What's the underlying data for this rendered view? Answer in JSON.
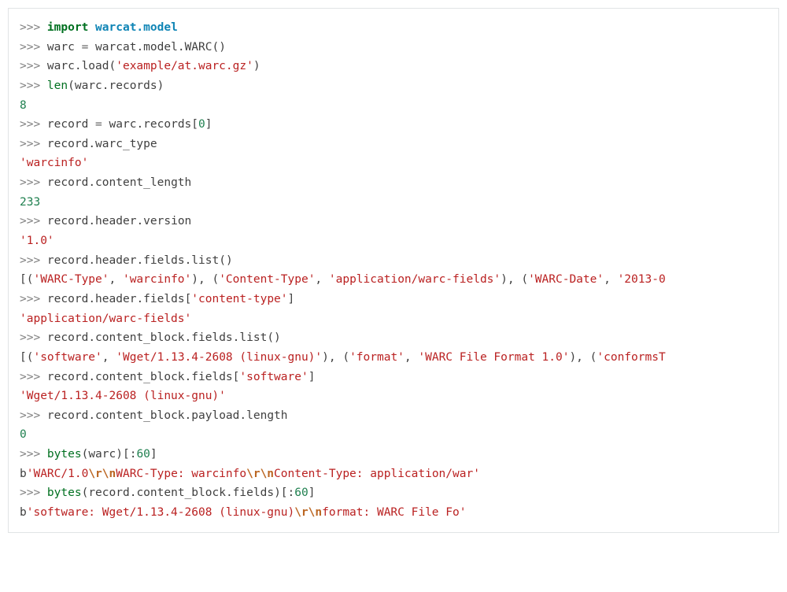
{
  "code": {
    "l1": {
      "prompt": ">>> ",
      "kw_import": "import",
      "space": " ",
      "module": "warcat.model"
    },
    "l2": {
      "prompt": ">>> ",
      "var": "warc",
      "eq": " = ",
      "ns": "warcat",
      "dot1": ".",
      "mod": "model",
      "dot2": ".",
      "cls": "WARC",
      "paren": "()"
    },
    "l3": {
      "prompt": ">>> ",
      "var": "warc",
      "dot": ".",
      "method": "load",
      "open": "(",
      "str": "'example/at.warc.gz'",
      "close": ")"
    },
    "l4": {
      "prompt": ">>> ",
      "builtin": "len",
      "open": "(",
      "var": "warc",
      "dot": ".",
      "attr": "records",
      "close": ")"
    },
    "l5": {
      "out": "8"
    },
    "l6": {
      "prompt": ">>> ",
      "var": "record",
      "eq": " = ",
      "src": "warc",
      "dot": ".",
      "attr": "records",
      "open": "[",
      "idx": "0",
      "close": "]"
    },
    "l7": {
      "prompt": ">>> ",
      "var": "record",
      "dot": ".",
      "attr": "warc_type"
    },
    "l8": {
      "out": "'warcinfo'"
    },
    "l9": {
      "prompt": ">>> ",
      "var": "record",
      "dot": ".",
      "attr": "content_length"
    },
    "l10": {
      "out": "233"
    },
    "l11": {
      "prompt": ">>> ",
      "var": "record",
      "dot1": ".",
      "a1": "header",
      "dot2": ".",
      "a2": "version"
    },
    "l12": {
      "out": "'1.0'"
    },
    "l13": {
      "prompt": ">>> ",
      "var": "record",
      "dot1": ".",
      "a1": "header",
      "dot2": ".",
      "a2": "fields",
      "dot3": ".",
      "method": "list",
      "paren": "()"
    },
    "l14": {
      "open1": "[(",
      "s1": "'WARC-Type'",
      "c1": ", ",
      "s2": "'warcinfo'",
      "close1": "), (",
      "s3": "'Content-Type'",
      "c2": ", ",
      "s4": "'application/warc-fields'",
      "close2": "), (",
      "s5": "'WARC-Date'",
      "c3": ", ",
      "s6": "'2013-0"
    },
    "l15": {
      "prompt": ">>> ",
      "var": "record",
      "dot1": ".",
      "a1": "header",
      "dot2": ".",
      "a2": "fields",
      "open": "[",
      "key": "'content-type'",
      "close": "]"
    },
    "l16": {
      "out": "'application/warc-fields'"
    },
    "l17": {
      "prompt": ">>> ",
      "var": "record",
      "dot1": ".",
      "a1": "content_block",
      "dot2": ".",
      "a2": "fields",
      "dot3": ".",
      "method": "list",
      "paren": "()"
    },
    "l18": {
      "open1": "[(",
      "s1": "'software'",
      "c1": ", ",
      "s2": "'Wget/1.13.4-2608 (linux-gnu)'",
      "close1": "), (",
      "s3": "'format'",
      "c2": ", ",
      "s4": "'WARC File Format 1.0'",
      "close2": "), (",
      "s5": "'conformsT"
    },
    "l19": {
      "prompt": ">>> ",
      "var": "record",
      "dot1": ".",
      "a1": "content_block",
      "dot2": ".",
      "a2": "fields",
      "open": "[",
      "key": "'software'",
      "close": "]"
    },
    "l20": {
      "out": "'Wget/1.13.4-2608 (linux-gnu)'"
    },
    "l21": {
      "prompt": ">>> ",
      "var": "record",
      "dot1": ".",
      "a1": "content_block",
      "dot2": ".",
      "a2": "payload",
      "dot3": ".",
      "a3": "length"
    },
    "l22": {
      "out": "0"
    },
    "l23": {
      "prompt": ">>> ",
      "builtin": "bytes",
      "open": "(",
      "var": "warc",
      "close": ")[:",
      "idx": "60",
      "close2": "]"
    },
    "l24": {
      "pfx": "b",
      "q1": "'WARC/1.0",
      "esc1": "\\r\\n",
      "mid1": "WARC-Type: warcinfo",
      "esc2": "\\r\\n",
      "mid2": "Content-Type: application/war'"
    },
    "l25": {
      "prompt": ">>> ",
      "builtin": "bytes",
      "open": "(",
      "var": "record",
      "dot1": ".",
      "a1": "content_block",
      "dot2": ".",
      "a2": "fields",
      "close": ")[:",
      "idx": "60",
      "close2": "]"
    },
    "l26": {
      "pfx": "b",
      "q1": "'software: Wget/1.13.4-2608 (linux-gnu)",
      "esc1": "\\r\\n",
      "mid1": "format: WARC File Fo'"
    }
  }
}
